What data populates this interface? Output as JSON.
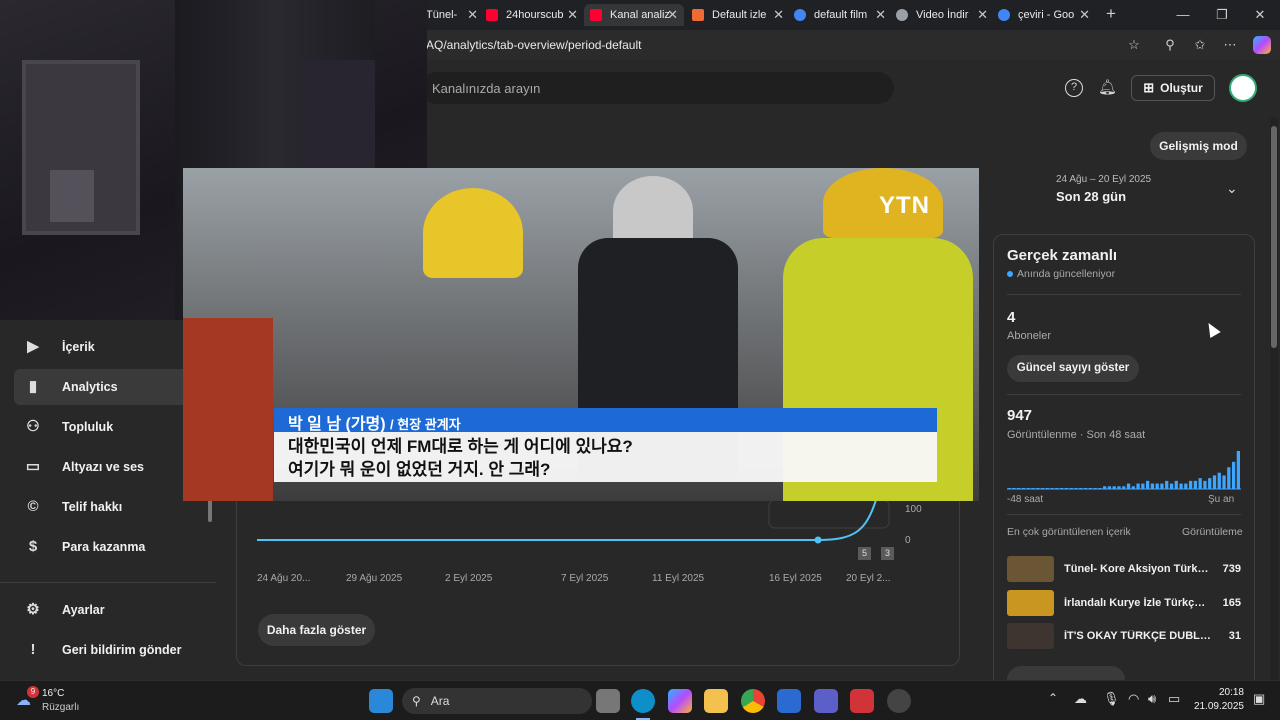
{
  "browser": {
    "tabs": [
      {
        "label": "Tünel-",
        "favicon_color": "#8ab4f8"
      },
      {
        "label": "24hourscub",
        "favicon_color": "#ff0033"
      },
      {
        "label": "Kanal analiz",
        "favicon_color": "#ff0033"
      },
      {
        "label": "Default izle",
        "favicon_color": "#f06a35"
      },
      {
        "label": "default film",
        "favicon_color": "#4285f4"
      },
      {
        "label": "Video İndir",
        "favicon_color": "#9aa0a6"
      },
      {
        "label": "çeviri - Goo",
        "favicon_color": "#4285f4"
      }
    ],
    "url": "AQ/analytics/tab-overview/period-default"
  },
  "header": {
    "search_placeholder": "Kanalınızda arayın",
    "create_label": "Oluştur"
  },
  "sidebar": {
    "items": [
      {
        "label": "İçerik",
        "icon": "play-icon"
      },
      {
        "label": "Analytics",
        "icon": "bar-chart-icon",
        "active": true
      },
      {
        "label": "Topluluk",
        "icon": "people-icon"
      },
      {
        "label": "Altyazı ve ses",
        "icon": "subtitles-icon"
      },
      {
        "label": "Telif hakkı",
        "icon": "copyright-icon"
      },
      {
        "label": "Para kazanma",
        "icon": "dollar-icon"
      },
      {
        "label": "Ayarlar",
        "icon": "gear-icon"
      },
      {
        "label": "Geri bildirim gönder",
        "icon": "feedback-icon"
      }
    ]
  },
  "video_overlay": {
    "watermark": "YTN",
    "caption_name": "박 일 남 (가명)",
    "caption_role": "/ 현장 관계자",
    "caption_line1": "대한민국이 언제 FM대로 하는 게 어디에 있나요?",
    "caption_line2": "여기가 뭐 운이 없었던 거지. 안 그래?"
  },
  "chart_data": {
    "type": "line",
    "x": [
      "24 Ağu 2025",
      "29 Ağu 2025",
      "2 Eyl 2025",
      "7 Eyl 2025",
      "11 Eyl 2025",
      "16 Eyl 2025",
      "20 Eyl 2025"
    ],
    "tick_labels": [
      "24 Ağu 20...",
      "29 Ağu 2025",
      "2 Eyl 2025",
      "7 Eyl 2025",
      "11 Eyl 2025",
      "16 Eyl 2025",
      "20 Eyl 2..."
    ],
    "y_ticks": [
      "100",
      "0"
    ],
    "series": [
      {
        "values": [
          0,
          0,
          0,
          0,
          0,
          0,
          140
        ]
      }
    ],
    "markers": [
      "5",
      "3"
    ],
    "color": "#4fc3f7"
  },
  "chart": {
    "more_label": "Daha fazla göster"
  },
  "right_panel": {
    "advanced_mode": "Gelişmiş mod",
    "date_range": "24 Ağu – 20 Eyl 2025",
    "period": "Son 28 gün",
    "realtime_title": "Gerçek zamanlı",
    "realtime_sub": "Anında güncelleniyor",
    "subscribers_value": "4",
    "subscribers_label": "Aboneler",
    "show_count_btn": "Güncel sayıyı göster",
    "views_value": "947",
    "views_label": "Görüntülenme · Son 48 saat",
    "spark_left": "-48 saat",
    "spark_right": "Şu an",
    "top_content_label": "En çok görüntülenen içerik",
    "top_content_col": "Görüntüleme",
    "top_content": [
      {
        "title": "Tünel- Kore Aksiyon Türkçe...",
        "views": "739",
        "thumb_color": "#6a5535"
      },
      {
        "title": "İrlandalı Kurye İzle Türkçe ...",
        "views": "165",
        "thumb_color": "#c9961f"
      },
      {
        "title": "İT'S OKAY TÜRKÇE DUBLAJ ...",
        "views": "31",
        "thumb_color": "#5a4a40"
      }
    ],
    "spark_values": [
      0,
      0,
      0,
      0,
      0,
      0,
      0,
      0,
      0,
      0,
      0,
      0,
      0,
      0,
      0,
      0,
      0,
      0,
      0,
      0,
      1,
      1,
      1,
      1,
      1,
      2,
      1,
      2,
      2,
      3,
      2,
      2,
      2,
      3,
      2,
      3,
      2,
      2,
      3,
      3,
      4,
      3,
      4,
      5,
      6,
      5,
      8,
      10,
      14
    ]
  },
  "taskbar": {
    "weather_temp": "16°C",
    "weather_desc": "Rüzgarlı",
    "weather_badge": "9",
    "search_label": "Ara",
    "time": "20:18",
    "date": "21.09.2025"
  }
}
